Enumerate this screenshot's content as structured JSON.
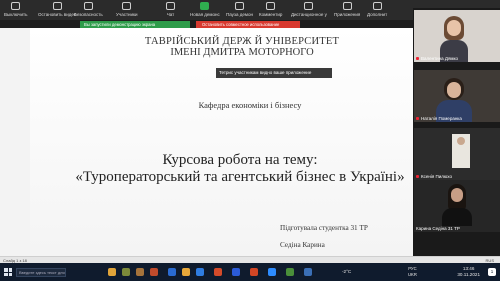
{
  "toolbar": {
    "items": [
      {
        "label": "Выключить",
        "icon": "mic-icon"
      },
      {
        "label": "Остановить видео",
        "icon": "video-icon"
      },
      {
        "label": "Безопасность",
        "icon": "shield-icon"
      },
      {
        "label": "Участники",
        "icon": "participants-icon"
      },
      {
        "label": "Чат",
        "icon": "chat-icon"
      },
      {
        "label": "Новая демонс",
        "icon": "share-icon"
      },
      {
        "label": "Пауза демон",
        "icon": "pause-icon"
      },
      {
        "label": "Комментир",
        "icon": "annotate-icon"
      },
      {
        "label": "Дистанционное у",
        "icon": "remote-icon"
      },
      {
        "label": "Приложения",
        "icon": "apps-icon"
      },
      {
        "label": "Дополнит",
        "icon": "more-icon"
      }
    ],
    "participants_count": "3"
  },
  "share_banner": "Вы запустили демонстрацию экрана",
  "stop_share": "Остановить совместное использование",
  "tooltip": "Тетрис участникам видно ваше приложение",
  "slide": {
    "university_line1": "ТАВРІЙСЬКИЙ ДЕРЖ                       Й УНІВЕРСИТЕТ",
    "university_line2": "ІМЕНІ ДМИТРА МОТОРНОГО",
    "department": "Кафедра економіки і бізнесу",
    "course_line": "Курсова робота на тему:",
    "title": "«Туроператорський та агентський бізнес в Україні»",
    "author_line1": "Підготувала студентка 31 ТР",
    "author_line2": "Седіна Карина"
  },
  "participants": [
    {
      "name": "Валентина Дямко",
      "mic_muted": true
    },
    {
      "name": "Наталія Померанка",
      "mic_muted": true
    },
    {
      "name": "Ксенія Пилюхо",
      "mic_muted": true
    },
    {
      "name": "Карина Седіна 31 ТР",
      "mic_muted": false
    }
  ],
  "statusbar": {
    "left": "Слайд 1 з 18",
    "right": "RUS"
  },
  "taskbar": {
    "search_placeholder": "Введите здесь текст для поиска",
    "weather": "-2°C",
    "lang_top": "РУС",
    "lang_bottom": "UKR",
    "time": "13:46",
    "date": "30.11.2021",
    "notifications": "1"
  },
  "colors": {
    "banner_green": "#2e9c4a",
    "stop_red": "#d8392f",
    "taskbar": "#0f1b2d"
  }
}
